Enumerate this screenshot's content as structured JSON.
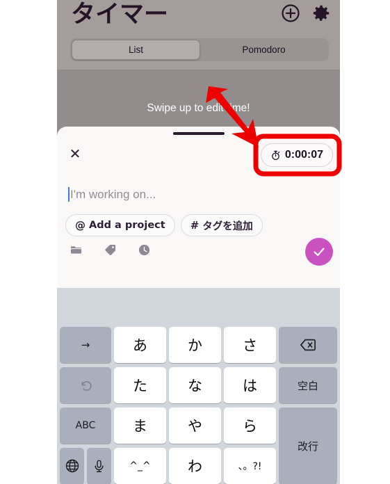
{
  "app": {
    "header": {
      "title": "タイマー",
      "add_icon": "plus-circle-icon",
      "settings_icon": "gear-icon"
    },
    "segmented_control": {
      "options": [
        "List",
        "Pomodoro"
      ],
      "selected": "List",
      "list_label": "List",
      "pomodoro_label": "Pomodoro"
    },
    "hint_text": "Swipe up to edit time!"
  },
  "sheet": {
    "close_label": "✕",
    "timer": {
      "icon": "stopwatch-icon",
      "value": "0:00:07"
    },
    "input": {
      "placeholder": "I'm working on...",
      "value": ""
    },
    "chips": [
      {
        "symbol": "@",
        "label": "Add a project",
        "name": "add-project-chip"
      },
      {
        "symbol": "#",
        "label": "タグを追加",
        "name": "add-tag-chip"
      }
    ],
    "tools": [
      {
        "icon": "folder-icon",
        "name": "folder-tool"
      },
      {
        "icon": "tag-icon",
        "name": "tag-tool"
      },
      {
        "icon": "clock-icon",
        "name": "clock-tool"
      }
    ],
    "submit": {
      "icon": "checkmark-icon",
      "color": "#c951c0"
    }
  },
  "keyboard": {
    "type": "japanese-kana",
    "rows": [
      [
        {
          "label": "→",
          "style": "dark",
          "name": "key-arrow-right"
        },
        {
          "label": "あ",
          "style": "light",
          "name": "key-a"
        },
        {
          "label": "か",
          "style": "light",
          "name": "key-ka"
        },
        {
          "label": "さ",
          "style": "light",
          "name": "key-sa"
        },
        {
          "label": "",
          "style": "dark",
          "name": "key-backspace",
          "icon": "backspace-icon"
        }
      ],
      [
        {
          "label": "",
          "style": "dark",
          "name": "key-undo",
          "icon": "undo-icon"
        },
        {
          "label": "た",
          "style": "light",
          "name": "key-ta"
        },
        {
          "label": "な",
          "style": "light",
          "name": "key-na"
        },
        {
          "label": "は",
          "style": "light",
          "name": "key-ha"
        },
        {
          "label": "空白",
          "style": "dark",
          "name": "key-space"
        }
      ],
      [
        {
          "label": "ABC",
          "style": "dark",
          "name": "key-abc"
        },
        {
          "label": "ま",
          "style": "light",
          "name": "key-ma"
        },
        {
          "label": "や",
          "style": "light",
          "name": "key-ya"
        },
        {
          "label": "ら",
          "style": "light",
          "name": "key-ra"
        },
        {
          "label": "改行",
          "style": "dark",
          "name": "key-return"
        }
      ],
      [
        {
          "label": "",
          "style": "dark",
          "name": "key-globe",
          "icon": "globe-icon"
        },
        {
          "label": "",
          "style": "dark",
          "name": "key-mic",
          "icon": "microphone-icon"
        },
        {
          "label": "^_^",
          "style": "light",
          "name": "key-emoticon"
        },
        {
          "label": "わ",
          "style": "light",
          "name": "key-wa"
        },
        {
          "label": "、。?!",
          "style": "light",
          "name": "key-punctuation"
        }
      ]
    ]
  },
  "annotation": {
    "arrow_color": "#ee0000",
    "highlight_color": "#ee0000",
    "arrow_name": "red-annotation-arrow",
    "highlight_name": "red-annotation-highlight-box"
  }
}
